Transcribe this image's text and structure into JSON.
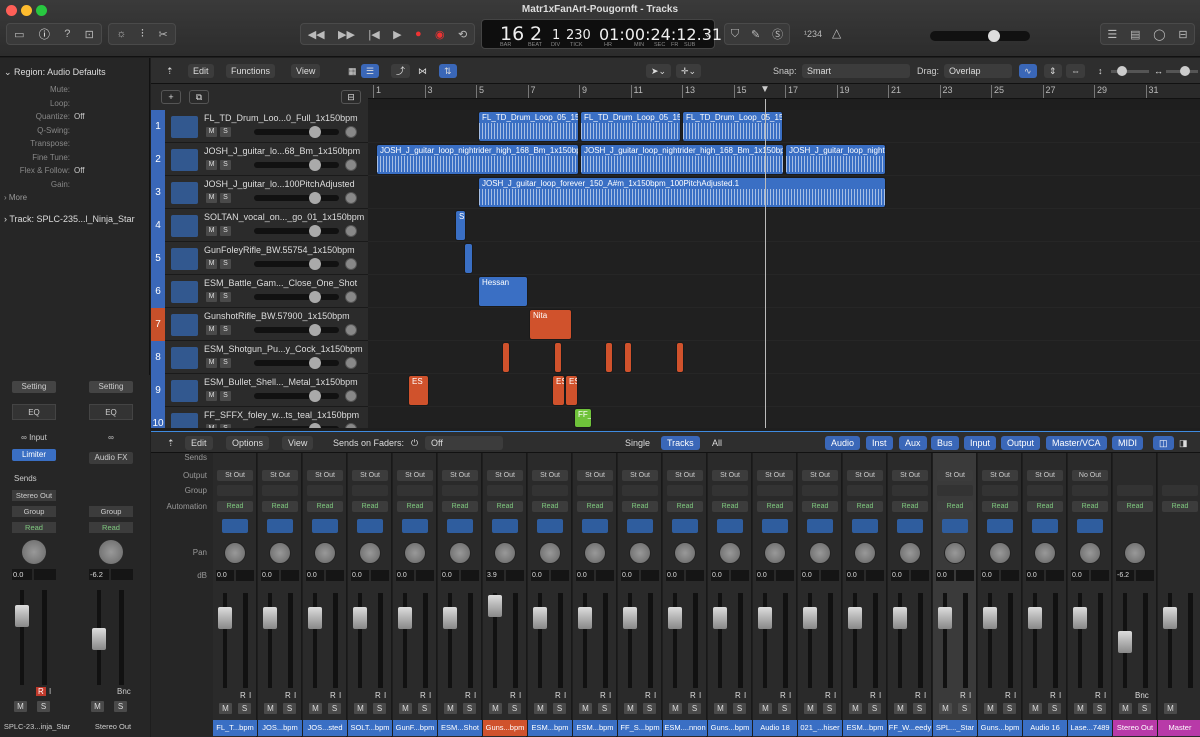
{
  "window": {
    "title": "Matr1xFanArt-Pougornft - Tracks"
  },
  "lcd": {
    "bar": "16",
    "beat": "2",
    "div": "1",
    "tick": "230",
    "time": "01:00:24:12.31",
    "bar_lbl": "BAR",
    "beat_lbl": "BEAT",
    "div_lbl": "DIV",
    "tick_lbl": "TICK",
    "hr_lbl": "HR",
    "min_lbl": "MIN",
    "sec_lbl": "SEC",
    "fr_lbl": "FR",
    "sub_lbl": "SUB",
    "tempo_badge": "¹234"
  },
  "inspector": {
    "region_label": "Region: Audio Defaults",
    "rows": [
      {
        "k": "Mute:",
        "v": ""
      },
      {
        "k": "Loop:",
        "v": ""
      },
      {
        "k": "Quantize:",
        "v": "Off"
      },
      {
        "k": "Q-Swing:",
        "v": ""
      },
      {
        "k": "Transpose:",
        "v": ""
      },
      {
        "k": "Fine Tune:",
        "v": ""
      },
      {
        "k": "Flex & Follow:",
        "v": "Off"
      },
      {
        "k": "Gain:",
        "v": ""
      }
    ],
    "more": "More",
    "track_label": "Track:  SPLC-235...l_Ninja_Star",
    "strip1": {
      "setting": "Setting",
      "eq": "EQ",
      "input": "Input",
      "limiter": "Limiter",
      "sends": "Sends",
      "stereo_out": "Stereo Out",
      "group": "Group",
      "read": "Read",
      "db": "0.0",
      "name": "SPLC-23...inja_Star",
      "m": "M",
      "s": "S",
      "r": "R",
      "i": "I"
    },
    "strip2": {
      "setting": "Setting",
      "eq": "EQ",
      "audiofx": "Audio FX",
      "group": "Group",
      "read": "Read",
      "db": "-6.2",
      "bnc": "Bnc",
      "name": "Stereo Out",
      "m": "M",
      "s": "S"
    }
  },
  "tracks_header": {
    "edit": "Edit",
    "functions": "Functions",
    "view": "View",
    "snap_lbl": "Snap:",
    "snap": "Smart",
    "drag_lbl": "Drag:",
    "drag": "Overlap"
  },
  "ruler": {
    "bars": [
      "1",
      "3",
      "5",
      "7",
      "9",
      "11",
      "13",
      "15",
      "17",
      "19",
      "21",
      "23",
      "25",
      "27",
      "29",
      "31"
    ]
  },
  "tracks": [
    {
      "num": "1",
      "name": "FL_TD_Drum_Loo...0_Full_1x150bpm"
    },
    {
      "num": "2",
      "name": "JOSH_J_guitar_lo...68_Bm_1x150bpm"
    },
    {
      "num": "3",
      "name": "JOSH_J_guitar_lo...100PitchAdjusted"
    },
    {
      "num": "4",
      "name": "SOLTAN_vocal_on..._go_01_1x150bpm"
    },
    {
      "num": "5",
      "name": "GunFoleyRifle_BW.55754_1x150bpm"
    },
    {
      "num": "6",
      "name": "ESM_Battle_Gam..._Close_One_Shot"
    },
    {
      "num": "7",
      "name": "GunshotRifle_BW.57900_1x150bpm"
    },
    {
      "num": "8",
      "name": "ESM_Shotgun_Pu...y_Cock_1x150bpm"
    },
    {
      "num": "9",
      "name": "ESM_Bullet_Shell..._Metal_1x150bpm"
    },
    {
      "num": "10",
      "name": "FF_SFFX_foley_w...ts_teal_1x150bpm"
    }
  ],
  "track_ctrl": {
    "m": "M",
    "s": "S"
  },
  "regions": {
    "r1a": "FL_TD_Drum_Loop_05_150",
    "r1b": "FL_TD_Drum_Loop_05_150",
    "r1c": "FL_TD_Drum_Loop_05_150",
    "r2a": "JOSH_J_guitar_loop_nightrider_high_168_Bm_1x150bp",
    "r2b": "JOSH_J_guitar_loop_nightrider_high_168_Bm_1x150bp",
    "r2c": "JOSH_J_guitar_loop_nightr",
    "r3": "JOSH_J_guitar_loop_forever_150_A#m_1x150bpm_100PitchAdjusted.1",
    "r4": "S",
    "r6": "Hessan",
    "r7": "Nita",
    "r9a": "ES",
    "r9b": "ES",
    "r9c": "ES",
    "r10": "FF_"
  },
  "mixer_header": {
    "edit": "Edit",
    "options": "Options",
    "view": "View",
    "sends_on_faders": "Sends on Faders:",
    "off": "Off",
    "single": "Single",
    "tracks": "Tracks",
    "all": "All",
    "audio": "Audio",
    "inst": "Inst",
    "aux": "Aux",
    "bus": "Bus",
    "input": "Input",
    "output": "Output",
    "mastervca": "Master/VCA",
    "midi": "MIDI"
  },
  "mixer_labels": {
    "sends": "Sends",
    "output": "Output",
    "group": "Group",
    "automation": "Automation",
    "pan": "Pan",
    "db": "dB"
  },
  "strips": [
    {
      "out": "St Out",
      "auto": "Read",
      "db": "0.0",
      "name": "FL_T...bpm",
      "color": "#3a6fc4"
    },
    {
      "out": "St Out",
      "auto": "Read",
      "db": "0.0",
      "name": "JOS...bpm",
      "color": "#3a6fc4"
    },
    {
      "out": "St Out",
      "auto": "Read",
      "db": "0.0",
      "name": "JOS...sted",
      "color": "#3a6fc4"
    },
    {
      "out": "St Out",
      "auto": "Read",
      "db": "0.0",
      "name": "SOLT...bpm",
      "color": "#3a6fc4"
    },
    {
      "out": "St Out",
      "auto": "Read",
      "db": "0.0",
      "name": "GunF...bpm",
      "color": "#3a6fc4"
    },
    {
      "out": "St Out",
      "auto": "Read",
      "db": "0.0",
      "name": "ESM...Shot",
      "color": "#3a6fc4"
    },
    {
      "out": "St Out",
      "auto": "Read",
      "db": "3.9",
      "name": "Guns...bpm",
      "color": "#d0522c"
    },
    {
      "out": "St Out",
      "auto": "Read",
      "db": "0.0",
      "name": "ESM...bpm",
      "color": "#3a6fc4"
    },
    {
      "out": "St Out",
      "auto": "Read",
      "db": "0.0",
      "name": "ESM...bpm",
      "color": "#3a6fc4"
    },
    {
      "out": "St Out",
      "auto": "Read",
      "db": "0.0",
      "name": "FF_S...bpm",
      "color": "#3a6fc4"
    },
    {
      "out": "St Out",
      "auto": "Read",
      "db": "0.0",
      "name": "ESM....nnon",
      "color": "#3a6fc4"
    },
    {
      "out": "St Out",
      "auto": "Read",
      "db": "0.0",
      "name": "Guns...bpm",
      "color": "#3a6fc4"
    },
    {
      "out": "St Out",
      "auto": "Read",
      "db": "0.0",
      "name": "Audio 18",
      "color": "#3a6fc4"
    },
    {
      "out": "St Out",
      "auto": "Read",
      "db": "0.0",
      "name": "021_...hiser",
      "color": "#3a6fc4"
    },
    {
      "out": "St Out",
      "auto": "Read",
      "db": "0.0",
      "name": "ESM...bpm",
      "color": "#3a6fc4"
    },
    {
      "out": "St Out",
      "auto": "Read",
      "db": "0.0",
      "name": "FF_W...eedy",
      "color": "#3a6fc4"
    },
    {
      "out": "St Out",
      "auto": "Read",
      "db": "0.0",
      "name": "SPL..._Star",
      "color": "#3a6fc4"
    },
    {
      "out": "St Out",
      "auto": "Read",
      "db": "0.0",
      "name": "Guns...bpm",
      "color": "#3a6fc4"
    },
    {
      "out": "St Out",
      "auto": "Read",
      "db": "0.0",
      "name": "Audio 16",
      "color": "#3a6fc4"
    },
    {
      "out": "No Out",
      "auto": "Read",
      "db": "0.0",
      "name": "Lase...7489",
      "color": "#3a6fc4"
    },
    {
      "out": "",
      "auto": "Read",
      "db": "-6.2",
      "name": "Stereo Out",
      "color": "#b83aa8"
    },
    {
      "out": "",
      "auto": "Read",
      "db": "",
      "name": "Master",
      "color": "#b83aa8"
    }
  ],
  "strip_ctrl": {
    "m": "M",
    "s": "S",
    "r": "R",
    "i": "I",
    "bnc": "Bnc"
  }
}
